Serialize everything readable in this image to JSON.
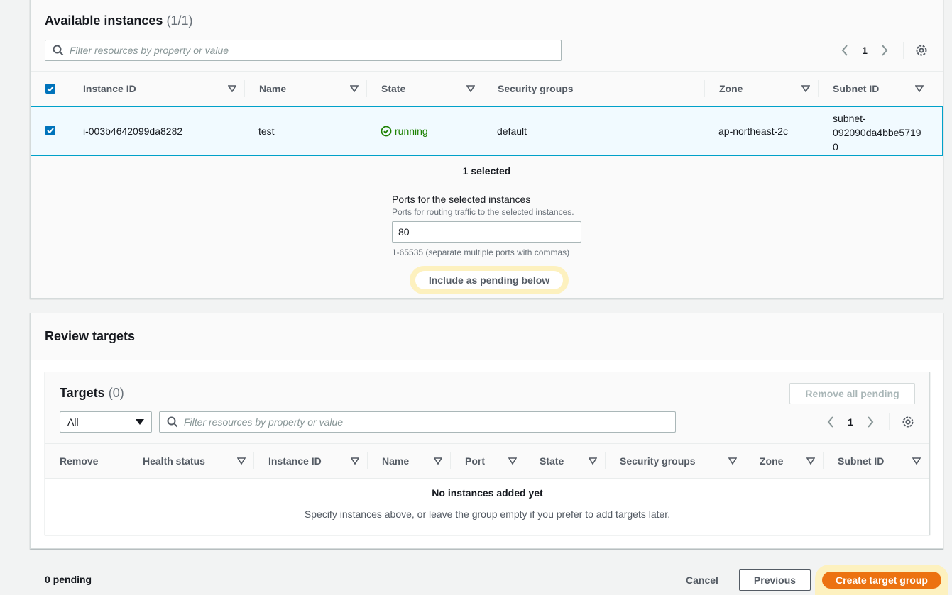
{
  "available": {
    "title": "Available instances",
    "count": "(1/1)",
    "search_placeholder": "Filter resources by property or value",
    "page": "1",
    "columns": [
      "Instance ID",
      "Name",
      "State",
      "Security groups",
      "Zone",
      "Subnet ID"
    ],
    "row": {
      "instance_id": "i-003b4642099da8282",
      "name": "test",
      "state": "running",
      "security_groups": "default",
      "zone": "ap-northeast-2c",
      "subnet_line1": "subnet-",
      "subnet_line2": "092090da4bbe5719",
      "subnet_line3": "0"
    },
    "selected_text": "1 selected",
    "ports_label": "Ports for the selected instances",
    "ports_desc": "Ports for routing traffic to the selected instances.",
    "ports_value": "80",
    "ports_hint": "1-65535 (separate multiple ports with commas)",
    "include_button": "Include as pending below"
  },
  "review": {
    "title": "Review targets",
    "targets_title": "Targets",
    "targets_count": "(0)",
    "remove_all_button": "Remove all pending",
    "filter_value": "All",
    "search_placeholder": "Filter resources by property or value",
    "page": "1",
    "columns": [
      "Remove",
      "Health status",
      "Instance ID",
      "Name",
      "Port",
      "State",
      "Security groups",
      "Zone",
      "Subnet ID"
    ],
    "empty_title": "No instances added yet",
    "empty_desc": "Specify instances above, or leave the group empty if you prefer to add targets later."
  },
  "footer": {
    "pending": "0 pending",
    "cancel": "Cancel",
    "previous": "Previous",
    "create": "Create target group"
  },
  "colors": {
    "accent": "#0073bb",
    "primary_button": "#ec7211",
    "running": "#1d8102",
    "highlight": "#fdf1bf"
  }
}
